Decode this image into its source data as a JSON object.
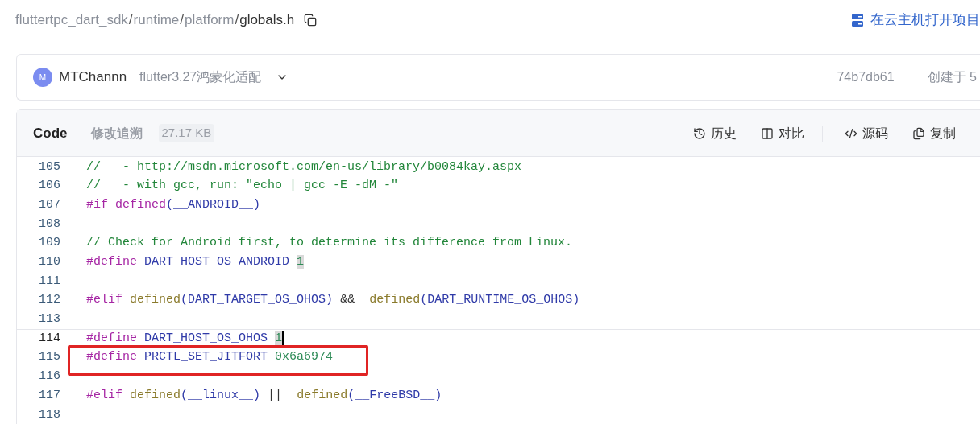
{
  "breadcrumb": {
    "segments": [
      "fluttertpc_dart_sdk",
      "runtime",
      "platform"
    ],
    "separator": "/",
    "file": "globals.h"
  },
  "open_in_cloud": "在云主机打开项目",
  "commit_bar": {
    "avatar_letter": "M",
    "author": "MTChannn",
    "message": "flutter3.27鸿蒙化适配",
    "hash": "74b7db61",
    "created": "创建于 5"
  },
  "file_header": {
    "tabs": [
      {
        "label": "Code",
        "selected": true
      },
      {
        "label": "修改追溯",
        "selected": false
      }
    ],
    "size": "27.17 KB",
    "actions": [
      {
        "kind": "history",
        "label": "历史"
      },
      {
        "kind": "compare",
        "label": "对比"
      },
      {
        "kind": "source",
        "label": "源码"
      },
      {
        "kind": "copy",
        "label": "复制"
      }
    ]
  },
  "code_lines": [
    {
      "number": "105",
      "current": false,
      "annotated": false,
      "tokens": [
        {
          "kind": "comment",
          "text": "//   -"
        },
        {
          "kind": "link",
          "text": "http://msdn.microsoft.com/en-us/library/b0084kay.aspx",
          "space": true
        }
      ]
    },
    {
      "number": "106",
      "current": false,
      "annotated": false,
      "tokens": [
        {
          "kind": "comment",
          "text": "//   - with gcc, run: \"echo | gcc -E -dM -\""
        }
      ]
    },
    {
      "number": "107",
      "current": false,
      "annotated": false,
      "tokens": [
        {
          "kind": "keyword",
          "text": "#if"
        },
        {
          "kind": "keyword",
          "text": "defined",
          "space": true
        },
        {
          "kind": "punct",
          "text": "("
        },
        {
          "kind": "ident",
          "text": "__ANDROID__"
        },
        {
          "kind": "punct",
          "text": ")"
        }
      ]
    },
    {
      "number": "108",
      "current": false,
      "annotated": false
    },
    {
      "number": "109",
      "current": false,
      "annotated": false,
      "tokens": [
        {
          "kind": "comment",
          "text": "// Check for Android first, to determine its difference from Linux."
        }
      ]
    },
    {
      "number": "110",
      "current": false,
      "annotated": false,
      "tokens": [
        {
          "kind": "keyword",
          "text": "#define"
        },
        {
          "kind": "ident",
          "text": "DART_HOST_OS_ANDROID",
          "space": true
        },
        {
          "kind": "number",
          "text": "1",
          "highlight": true,
          "space": true
        }
      ]
    },
    {
      "number": "111",
      "current": false,
      "annotated": false
    },
    {
      "number": "112",
      "current": false,
      "annotated": false,
      "tokens": [
        {
          "kind": "keyword",
          "text": "#elif"
        },
        {
          "kind": "func",
          "text": "defined",
          "space": true
        },
        {
          "kind": "punct",
          "text": "("
        },
        {
          "kind": "ident",
          "text": "DART_TARGET_OS_OHOS"
        },
        {
          "kind": "punct",
          "text": ")"
        },
        {
          "kind": "plain",
          "text": "&&",
          "space": true
        },
        {
          "kind": "func",
          "text": "defined",
          "space": true
        },
        {
          "kind": "punct",
          "text": "("
        },
        {
          "kind": "ident",
          "text": "DART_RUNTIME_OS_OHOS"
        },
        {
          "kind": "punct",
          "text": ")"
        }
      ]
    },
    {
      "number": "113",
      "current": false,
      "annotated": false
    },
    {
      "number": "114",
      "current": true,
      "annotated": false,
      "tokens": [
        {
          "kind": "keyword",
          "text": "#define"
        },
        {
          "kind": "ident",
          "text": "DART_HOST_OS_OHOS",
          "space": true
        },
        {
          "kind": "number",
          "text": "1",
          "highlight": true,
          "space": true
        }
      ]
    },
    {
      "number": "115",
      "current": false,
      "annotated": true,
      "tokens": [
        {
          "kind": "keyword",
          "text": "#define"
        },
        {
          "kind": "ident",
          "text": "PRCTL_SET_JITFORT",
          "space": true
        },
        {
          "kind": "number",
          "text": "0x6a6974",
          "space": true
        }
      ]
    },
    {
      "number": "116",
      "current": false,
      "annotated": false
    },
    {
      "number": "117",
      "current": false,
      "annotated": false,
      "tokens": [
        {
          "kind": "keyword",
          "text": "#elif"
        },
        {
          "kind": "func",
          "text": "defined",
          "space": true
        },
        {
          "kind": "punct",
          "text": "("
        },
        {
          "kind": "ident",
          "text": "__linux__"
        },
        {
          "kind": "punct",
          "text": ")"
        },
        {
          "kind": "plain",
          "text": "||",
          "space": true
        },
        {
          "kind": "func",
          "text": "defined",
          "space": true
        },
        {
          "kind": "punct",
          "text": "("
        },
        {
          "kind": "ident",
          "text": "__FreeBSD__"
        },
        {
          "kind": "punct",
          "text": ")"
        }
      ]
    },
    {
      "number": "118",
      "current": false,
      "annotated": false
    }
  ]
}
